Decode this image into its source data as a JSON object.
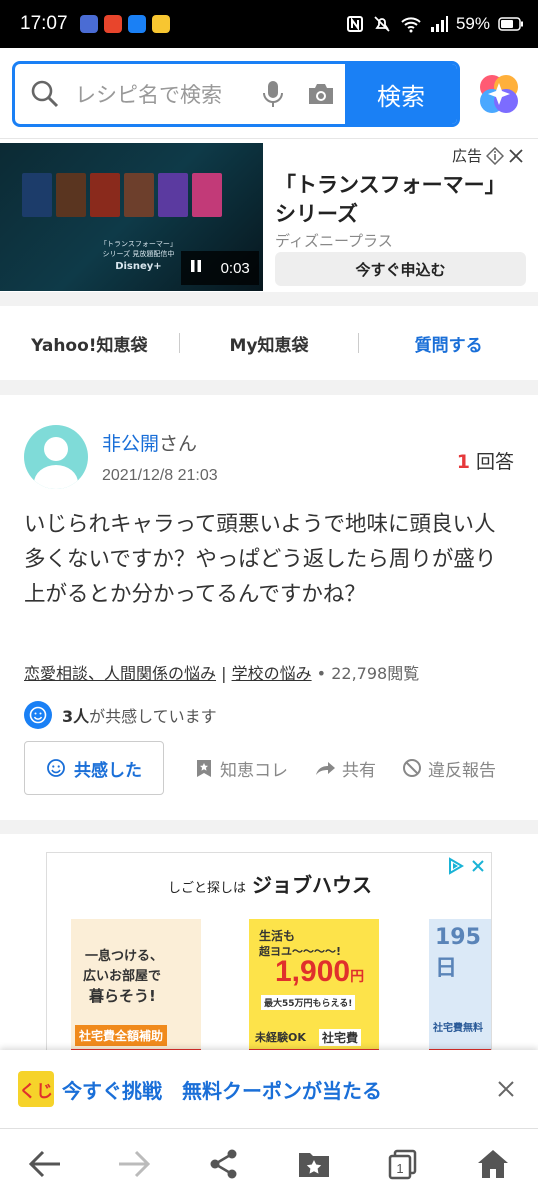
{
  "status_bar": {
    "time": "17:07",
    "battery": "59%"
  },
  "search": {
    "placeholder": "レシピ名で検索",
    "button": "検索"
  },
  "ad_banner": {
    "ad_label": "広告",
    "title": "「トランスフォーマー」シリーズ",
    "advertiser": "ディズニープラス",
    "cta": "今すぐ申込む",
    "video_time": "0:03",
    "video_caption_1": "「トランスフォーマー」",
    "video_caption_2": "シリーズ 見放題配信中",
    "video_brand": "Disney+"
  },
  "tabs": [
    {
      "label": "Yahoo!知恵袋"
    },
    {
      "label": "My知恵袋"
    },
    {
      "label": "質問する"
    }
  ],
  "question": {
    "user": "非公開",
    "honorific": "さん",
    "date": "2021/12/8 21:03",
    "answer_count": "1",
    "answer_label": "回答",
    "text": "いじられキャラって頭悪いようで地味に頭良い人多くないですか？やっぱどう返したら周りが盛り上がるとか分かってるんですかね？",
    "category_1": "恋愛相談、人間関係の悩み",
    "category_sep": " | ",
    "category_2": "学校の悩み",
    "views": " • 22,798閲覧",
    "empathy_count": "3人",
    "empathy_text": "が共感しています",
    "empathize_button": "共感した",
    "action_chie_kore": "知恵コレ",
    "action_share": "共有",
    "action_report": "違反報告"
  },
  "ad2": {
    "brand_prefix": "しごと探しは",
    "brand": "ジョブハウス",
    "poster1_line1": "一息つける、",
    "poster1_line2": "広いお部屋で",
    "poster1_line3": "暮らそう!",
    "poster1_badge": "社宅費全額補助",
    "poster2_line1": "生活も",
    "poster2_line2": "超ヨユ〜〜〜〜!",
    "poster2_amount": "1,900",
    "poster2_unit": "円",
    "poster2_bonus": "最大55万円もらえる!",
    "poster2_foot": "未経験OK",
    "poster2_tag": "社宅費",
    "poster3_line1": "195日",
    "poster3_line2": "社宅費無料"
  },
  "coupon_bar": {
    "logo": "くじ",
    "text": "今すぐ挑戦　無料クーポンが当たる"
  },
  "bottom_nav": {
    "tab_count": "1"
  }
}
